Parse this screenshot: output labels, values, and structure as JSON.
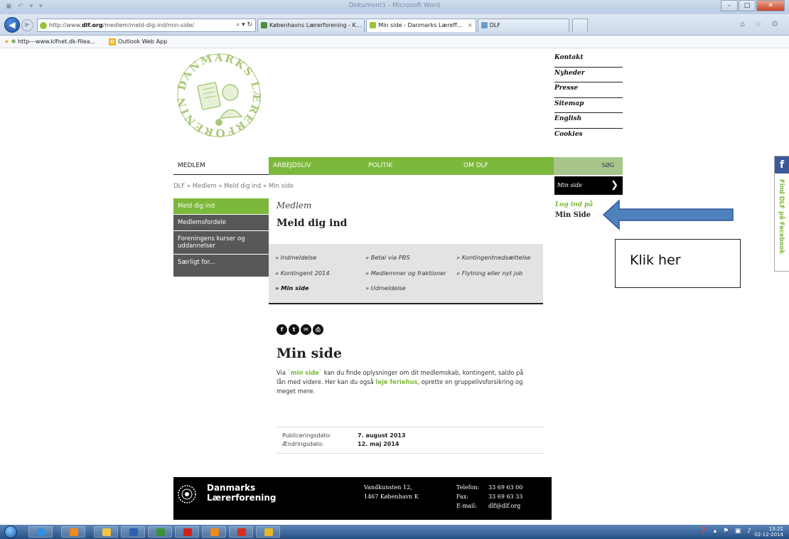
{
  "window": {
    "title": "Dokument1 - Microsoft Word"
  },
  "browser": {
    "url_prefix": "http://www.",
    "url_domain": "dlf.org",
    "url_path": "/medlem/meld-dig-ind/min-side/",
    "addr_controls": "⌕ ▾ ↻",
    "tabs": [
      {
        "label": "Københavns Lærerforening - K...",
        "color": "#4f8f3a"
      },
      {
        "label": "Min side - Danmarks Læreff...",
        "color": "#9bc23c",
        "close": "×"
      },
      {
        "label": "DLF",
        "color": "#6a9ad0"
      }
    ],
    "tool_icons": "⌂ ☆ ⚙"
  },
  "favorites": {
    "item1": "http---www.klfnet.dk-filea...",
    "item2": "Outlook Web App",
    "owa_letter": "O"
  },
  "site": {
    "top_links": [
      "Kontakt",
      "Nyheder",
      "Presse",
      "Sitemap",
      "English",
      "Cookies"
    ],
    "nav": {
      "medlem": "MEDLEM",
      "arbejdsliv": "ARBEJDSLIV",
      "politik": "POLITIK",
      "om_dlf": "OM DLF",
      "search": "SØG"
    },
    "breadcrumb": {
      "a": "DLF",
      "sep": " » ",
      "b": "Medlem",
      "c": "Meld dig ind",
      "d": "Min side"
    },
    "sidebar": [
      "Meld dig ind",
      "Medlemsfordele",
      "Foreningens kurser og uddannelser",
      "Særligt for..."
    ],
    "section_label": "Medlem",
    "page_heading": "Meld dig ind",
    "subnav": {
      "col1": [
        "» Indmeldelse",
        "» Kontingent 2014",
        "» Min side"
      ],
      "col2": [
        "» Betal via PBS",
        "» Medlemmer og fraktioner",
        "» Udmeldelse"
      ],
      "col3": [
        "» Kontingentnedsættelse",
        "» Flytning eller nyt job"
      ]
    },
    "social": [
      "f",
      "t",
      "✉",
      "⎙"
    ],
    "article": {
      "title": "Min side",
      "p1": "Via ",
      "link1": "`min side`",
      "p2": " kan du finde oplysninger om dit medlemskab, kontingent, saldo på lån med videre. Her kan du også ",
      "link2": "leje feriehus",
      "p3": ", oprette en gruppelivsforsikring og meget mere."
    },
    "dates": {
      "pub_label": "Publiceringsdato:",
      "pub_value": "7. august 2013",
      "mod_label": "Ændringsdato:",
      "mod_value": "12. maj 2014"
    },
    "right_box": {
      "label": "Min side",
      "arrow": "❯"
    },
    "login": {
      "line1": "Log ind på",
      "line2": "Min Side"
    },
    "callout": "Klik her",
    "facebook": {
      "icon": "f",
      "text": "Find DLF på Facebook"
    },
    "footer": {
      "name1": "Danmarks",
      "name2": "Lærerforening",
      "addr1": "Vandkunsten 12,",
      "addr2": "1467 København K",
      "phone_label": "Telefon:",
      "phone": "33 69 63 00",
      "fax_label": "Fax:",
      "fax": "33 69 63 33",
      "email_label": "E-mail:",
      "email": "dlf@dlf.org"
    }
  },
  "taskbar": {
    "apps": [
      {
        "name": "ie",
        "color": "#2d8fe3"
      },
      {
        "name": "outlook",
        "color": "#f08a1c"
      },
      {
        "name": "explorer",
        "color": "#f2c447"
      },
      {
        "name": "word",
        "color": "#2b5fb3"
      },
      {
        "name": "excel",
        "color": "#3b8f3b"
      },
      {
        "name": "acrobat",
        "color": "#d2221a"
      },
      {
        "name": "office",
        "color": "#f08a1c"
      },
      {
        "name": "flash",
        "color": "#d43020"
      },
      {
        "name": "other",
        "color": "#e6b82a"
      }
    ],
    "time": "13:21",
    "date": "02-12-2014",
    "tray_icons": "❓ ▴ ⚑ ▣ ♪"
  }
}
